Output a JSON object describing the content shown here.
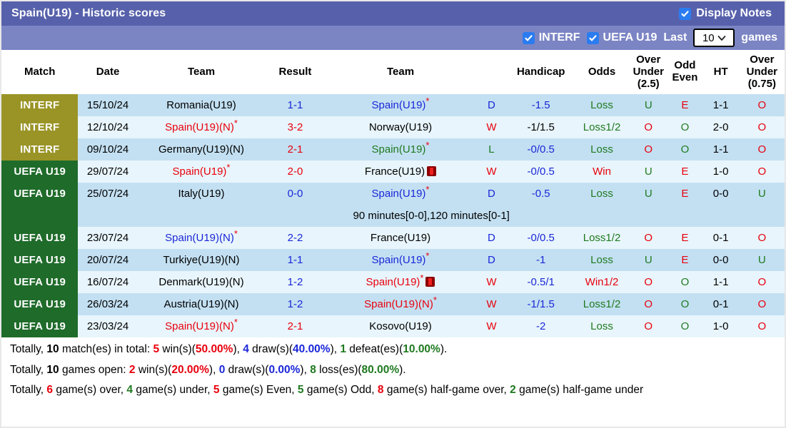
{
  "header": {
    "title": "Spain(U19) - Historic scores",
    "display_notes_label": "Display Notes",
    "display_notes_checked": true
  },
  "options": {
    "interf_label": "INTERF",
    "interf_checked": true,
    "uefa_label": "UEFA U19",
    "uefa_checked": true,
    "last_label": "Last",
    "games_count": "10",
    "games_label": "games"
  },
  "columns": {
    "match": "Match",
    "date": "Date",
    "team_home": "Team",
    "result": "Result",
    "team_away": "Team",
    "handicap": "Handicap",
    "odds": "Odds",
    "over_under_25_l1": "Over",
    "over_under_25_l2": "Under",
    "over_under_25_l3": "(2.5)",
    "odd_even_l1": "Odd",
    "odd_even_l2": "Even",
    "ht": "HT",
    "over_under_075_l1": "Over",
    "over_under_075_l2": "Under",
    "over_under_075_l3": "(0.75)"
  },
  "rows": [
    {
      "comp": "INTERF",
      "comp_type": "interf",
      "date": "15/10/24",
      "home": "Romania(U19)",
      "home_color": "black",
      "home_star": false,
      "score_left": "1",
      "score_sep": "-",
      "score_right": "1",
      "score_color": "blue",
      "away": "Spain(U19)",
      "away_color": "blue",
      "away_star": true,
      "away_redcard": false,
      "result": "D",
      "result_color": "blue",
      "handicap": "-1.5",
      "handicap_color": "blue",
      "odds": "Loss",
      "odds_color": "green",
      "ou25": "U",
      "ou25_color": "green",
      "oddeven": "E",
      "oddeven_color": "red",
      "ht": "1-1",
      "ou075": "O",
      "ou075_color": "red",
      "note": null
    },
    {
      "comp": "INTERF",
      "comp_type": "interf",
      "date": "12/10/24",
      "home": "Spain(U19)(N)",
      "home_color": "red",
      "home_star": true,
      "score_left": "3",
      "score_sep": "-",
      "score_right": "2",
      "score_color": "red",
      "away": "Norway(U19)",
      "away_color": "black",
      "away_star": false,
      "away_redcard": false,
      "result": "W",
      "result_color": "red",
      "handicap": "-1/1.5",
      "handicap_color": "black",
      "odds": "Loss1/2",
      "odds_color": "green",
      "ou25": "O",
      "ou25_color": "red",
      "oddeven": "O",
      "oddeven_color": "green",
      "ht": "2-0",
      "ou075": "O",
      "ou075_color": "red",
      "note": null
    },
    {
      "comp": "INTERF",
      "comp_type": "interf",
      "date": "09/10/24",
      "home": "Germany(U19)(N)",
      "home_color": "black",
      "home_star": false,
      "score_left": "2",
      "score_sep": "-",
      "score_right": "1",
      "score_color": "red",
      "away": "Spain(U19)",
      "away_color": "green",
      "away_star": true,
      "away_redcard": false,
      "result": "L",
      "result_color": "green",
      "handicap": "-0/0.5",
      "handicap_color": "blue",
      "odds": "Loss",
      "odds_color": "green",
      "ou25": "O",
      "ou25_color": "red",
      "oddeven": "O",
      "oddeven_color": "green",
      "ht": "1-1",
      "ou075": "O",
      "ou075_color": "red",
      "note": null
    },
    {
      "comp": "UEFA U19",
      "comp_type": "uefa",
      "date": "29/07/24",
      "home": "Spain(U19)",
      "home_color": "red",
      "home_star": true,
      "score_left": "2",
      "score_sep": "-",
      "score_right": "0",
      "score_color": "red",
      "away": "France(U19)",
      "away_color": "black",
      "away_star": false,
      "away_redcard": true,
      "result": "W",
      "result_color": "red",
      "handicap": "-0/0.5",
      "handicap_color": "blue",
      "odds": "Win",
      "odds_color": "red",
      "ou25": "U",
      "ou25_color": "green",
      "oddeven": "E",
      "oddeven_color": "red",
      "ht": "1-0",
      "ou075": "O",
      "ou075_color": "red",
      "note": null
    },
    {
      "comp": "UEFA U19",
      "comp_type": "uefa",
      "date": "25/07/24",
      "home": "Italy(U19)",
      "home_color": "black",
      "home_star": false,
      "score_left": "0",
      "score_sep": "-",
      "score_right": "0",
      "score_color": "blue",
      "away": "Spain(U19)",
      "away_color": "blue",
      "away_star": true,
      "away_redcard": false,
      "result": "D",
      "result_color": "blue",
      "handicap": "-0.5",
      "handicap_color": "blue",
      "odds": "Loss",
      "odds_color": "green",
      "ou25": "U",
      "ou25_color": "green",
      "oddeven": "E",
      "oddeven_color": "red",
      "ht": "0-0",
      "ou075": "U",
      "ou075_color": "green",
      "note": "90 minutes[0-0],120 minutes[0-1]"
    },
    {
      "comp": "UEFA U19",
      "comp_type": "uefa",
      "date": "23/07/24",
      "home": "Spain(U19)(N)",
      "home_color": "blue",
      "home_star": true,
      "score_left": "2",
      "score_sep": "-",
      "score_right": "2",
      "score_color": "blue",
      "away": "France(U19)",
      "away_color": "black",
      "away_star": false,
      "away_redcard": false,
      "result": "D",
      "result_color": "blue",
      "handicap": "-0/0.5",
      "handicap_color": "blue",
      "odds": "Loss1/2",
      "odds_color": "green",
      "ou25": "O",
      "ou25_color": "red",
      "oddeven": "E",
      "oddeven_color": "red",
      "ht": "0-1",
      "ou075": "O",
      "ou075_color": "red",
      "note": null
    },
    {
      "comp": "UEFA U19",
      "comp_type": "uefa",
      "date": "20/07/24",
      "home": "Turkiye(U19)(N)",
      "home_color": "black",
      "home_star": false,
      "score_left": "1",
      "score_sep": "-",
      "score_right": "1",
      "score_color": "blue",
      "away": "Spain(U19)",
      "away_color": "blue",
      "away_star": true,
      "away_redcard": false,
      "result": "D",
      "result_color": "blue",
      "handicap": "-1",
      "handicap_color": "blue",
      "odds": "Loss",
      "odds_color": "green",
      "ou25": "U",
      "ou25_color": "green",
      "oddeven": "E",
      "oddeven_color": "red",
      "ht": "0-0",
      "ou075": "U",
      "ou075_color": "green",
      "note": null
    },
    {
      "comp": "UEFA U19",
      "comp_type": "uefa",
      "date": "16/07/24",
      "home": "Denmark(U19)(N)",
      "home_color": "black",
      "home_star": false,
      "score_left": "1",
      "score_sep": "-",
      "score_right": "2",
      "score_color": "blue",
      "away": "Spain(U19)",
      "away_color": "red",
      "away_star": true,
      "away_redcard": true,
      "result": "W",
      "result_color": "red",
      "handicap": "-0.5/1",
      "handicap_color": "blue",
      "odds": "Win1/2",
      "odds_color": "red",
      "ou25": "O",
      "ou25_color": "red",
      "oddeven": "O",
      "oddeven_color": "green",
      "ht": "1-1",
      "ou075": "O",
      "ou075_color": "red",
      "note": null
    },
    {
      "comp": "UEFA U19",
      "comp_type": "uefa",
      "date": "26/03/24",
      "home": "Austria(U19)(N)",
      "home_color": "black",
      "home_star": false,
      "score_left": "1",
      "score_sep": "-",
      "score_right": "2",
      "score_color": "blue",
      "away": "Spain(U19)(N)",
      "away_color": "red",
      "away_star": true,
      "away_redcard": false,
      "result": "W",
      "result_color": "red",
      "handicap": "-1/1.5",
      "handicap_color": "blue",
      "odds": "Loss1/2",
      "odds_color": "green",
      "ou25": "O",
      "ou25_color": "red",
      "oddeven": "O",
      "oddeven_color": "green",
      "ht": "0-1",
      "ou075": "O",
      "ou075_color": "red",
      "note": null
    },
    {
      "comp": "UEFA U19",
      "comp_type": "uefa",
      "date": "23/03/24",
      "home": "Spain(U19)(N)",
      "home_color": "red",
      "home_star": true,
      "score_left": "2",
      "score_sep": "-",
      "score_right": "1",
      "score_color": "red",
      "away": "Kosovo(U19)",
      "away_color": "black",
      "away_star": false,
      "away_redcard": false,
      "result": "W",
      "result_color": "red",
      "handicap": "-2",
      "handicap_color": "blue",
      "odds": "Loss",
      "odds_color": "green",
      "ou25": "O",
      "ou25_color": "red",
      "oddeven": "O",
      "oddeven_color": "green",
      "ht": "1-0",
      "ou075": "O",
      "ou075_color": "red",
      "note": null
    }
  ],
  "summary": {
    "line1": [
      {
        "t": "Totally, ",
        "c": "plain"
      },
      {
        "t": "10",
        "c": "black"
      },
      {
        "t": " match(es) in total: ",
        "c": "plain"
      },
      {
        "t": "5",
        "c": "red"
      },
      {
        "t": " win(s)(",
        "c": "plain"
      },
      {
        "t": "50.00%",
        "c": "red"
      },
      {
        "t": "), ",
        "c": "plain"
      },
      {
        "t": "4",
        "c": "blue"
      },
      {
        "t": " draw(s)(",
        "c": "plain"
      },
      {
        "t": "40.00%",
        "c": "blue"
      },
      {
        "t": "), ",
        "c": "plain"
      },
      {
        "t": "1",
        "c": "green"
      },
      {
        "t": " defeat(es)(",
        "c": "plain"
      },
      {
        "t": "10.00%",
        "c": "green"
      },
      {
        "t": ").",
        "c": "plain"
      }
    ],
    "line2": [
      {
        "t": "Totally, ",
        "c": "plain"
      },
      {
        "t": "10",
        "c": "black"
      },
      {
        "t": " games open: ",
        "c": "plain"
      },
      {
        "t": "2",
        "c": "red"
      },
      {
        "t": " win(s)(",
        "c": "plain"
      },
      {
        "t": "20.00%",
        "c": "red"
      },
      {
        "t": "), ",
        "c": "plain"
      },
      {
        "t": "0",
        "c": "blue"
      },
      {
        "t": " draw(s)(",
        "c": "plain"
      },
      {
        "t": "0.00%",
        "c": "blue"
      },
      {
        "t": "), ",
        "c": "plain"
      },
      {
        "t": "8",
        "c": "green"
      },
      {
        "t": " loss(es)(",
        "c": "plain"
      },
      {
        "t": "80.00%",
        "c": "green"
      },
      {
        "t": ").",
        "c": "plain"
      }
    ],
    "line3": [
      {
        "t": "Totally, ",
        "c": "plain"
      },
      {
        "t": "6",
        "c": "red"
      },
      {
        "t": " game(s) over, ",
        "c": "plain"
      },
      {
        "t": "4",
        "c": "green"
      },
      {
        "t": " game(s) under, ",
        "c": "plain"
      },
      {
        "t": "5",
        "c": "red"
      },
      {
        "t": " game(s) Even, ",
        "c": "plain"
      },
      {
        "t": "5",
        "c": "green"
      },
      {
        "t": " game(s) Odd, ",
        "c": "plain"
      },
      {
        "t": "8",
        "c": "red"
      },
      {
        "t": " game(s) half-game over, ",
        "c": "plain"
      },
      {
        "t": "2",
        "c": "green"
      },
      {
        "t": " game(s) half-game under",
        "c": "plain"
      }
    ]
  }
}
